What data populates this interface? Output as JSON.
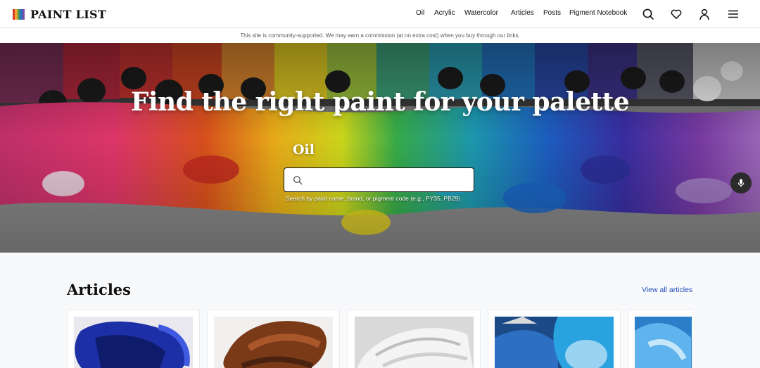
{
  "brand": {
    "name": "PAINT LIST"
  },
  "nav": {
    "links": [
      "Oil",
      "Acrylic",
      "Watercolor",
      "Articles",
      "Posts",
      "Pigment Notebook"
    ]
  },
  "header_icons": [
    "search-icon",
    "heart-icon",
    "user-icon",
    "menu-icon"
  ],
  "notice": "This site is community-supported. We may earn a commission (at no extra cost) when you buy through our links.",
  "hero": {
    "title": "Find the right paint for your palette",
    "medium": "Oil",
    "search_value": "",
    "search_help": "Search by paint name, brand, or pigment code (e.g., PY35, PB29)",
    "mic_icon": "microphone-icon"
  },
  "articles": {
    "heading": "Articles",
    "view_all": "View all articles"
  },
  "colors": {
    "link": "#1a4fb8",
    "text": "#111111",
    "page_bg": "#f8f9fb"
  }
}
